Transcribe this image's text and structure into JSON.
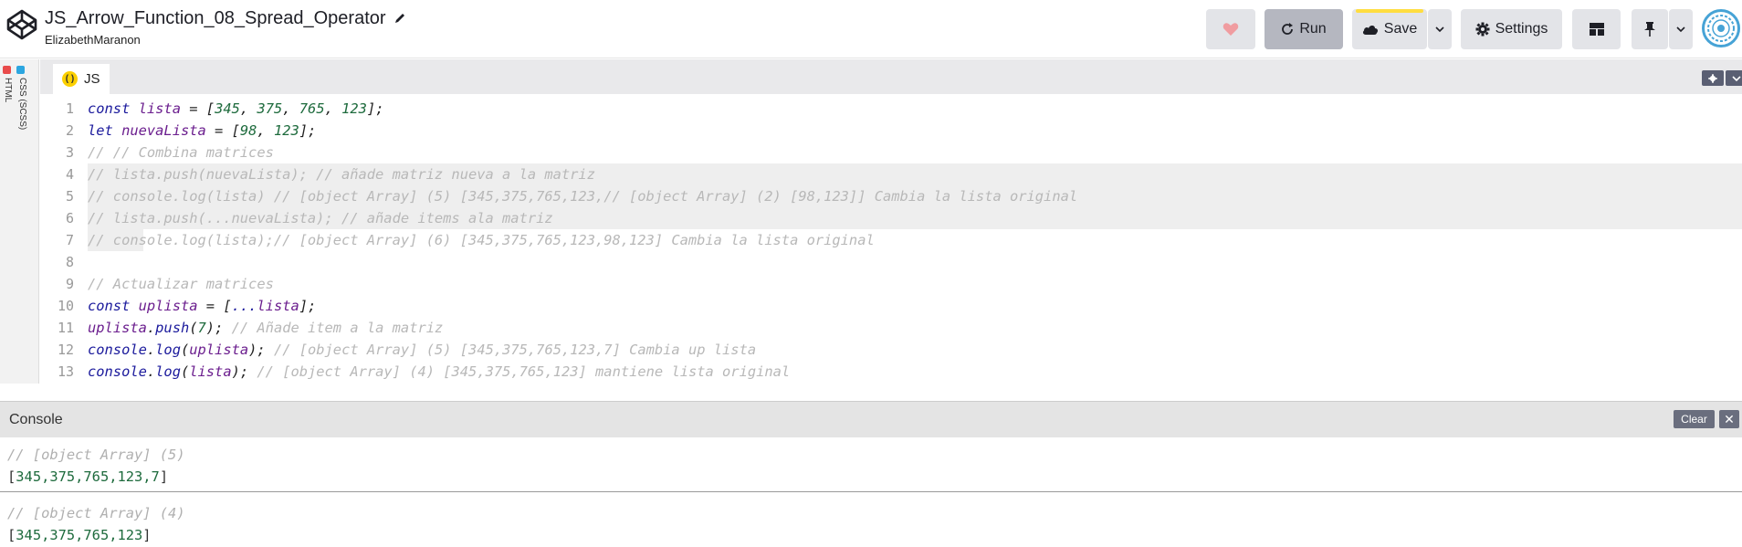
{
  "header": {
    "title": "JS_Arrow_Function_08_Spread_Operator",
    "author": "ElizabethMaranon",
    "run_label": "Run",
    "save_label": "Save",
    "settings_label": "Settings"
  },
  "side_tabs": {
    "html": "HTML",
    "css": "CSS (SCSS)"
  },
  "editor": {
    "tab_label": "JS",
    "tab_icon": "( )",
    "line_numbers": [
      "1",
      "2",
      "3",
      "4",
      "5",
      "6",
      "7",
      "8",
      "9",
      "10",
      "11",
      "12",
      "13"
    ]
  },
  "console": {
    "title": "Console",
    "clear_label": "Clear",
    "close_label": "✕",
    "entries": [
      {
        "comment": "// [object Array] (5)",
        "value": "345,375,765,123,7"
      },
      {
        "comment": "// [object Array] (4)",
        "value": "345,375,765,123"
      }
    ]
  },
  "colors": {
    "keyword": "#1b1a9c",
    "variable": "#6b1e8e",
    "number": "#1e6b3d",
    "comment": "#b8b8b8",
    "save_accent": "#ffdd40",
    "js_icon": "#fcd000"
  },
  "icons": [
    "codepen-logo-icon",
    "pencil-icon",
    "heart-icon",
    "refresh-icon",
    "cloud-icon",
    "chevron-down-icon",
    "gear-icon",
    "layout-icon",
    "pin-icon"
  ]
}
